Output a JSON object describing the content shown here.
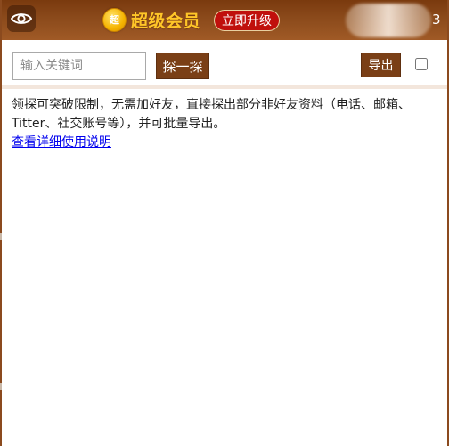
{
  "header": {
    "eye_icon": "eye-icon",
    "vip_badge_text": "超",
    "vip_label": "超级会员",
    "upgrade_label": "立即升级",
    "count": "3"
  },
  "toolbar": {
    "search_placeholder": "输入关键词",
    "search_value": "",
    "probe_label": "探一探",
    "export_label": "导出"
  },
  "content": {
    "description": "领探可突破限制，无需加好友，直接探出部分非好友资料（电话、邮箱、Titter、社交账号等），并可批量导出。",
    "help_link": "查看详细使用说明"
  },
  "colors": {
    "header_brown": "#8b4a1b",
    "button_brown": "#7a3f16",
    "vip_gold": "#ffc628",
    "upgrade_red": "#c0100c",
    "link_blue": "#0000ee"
  }
}
